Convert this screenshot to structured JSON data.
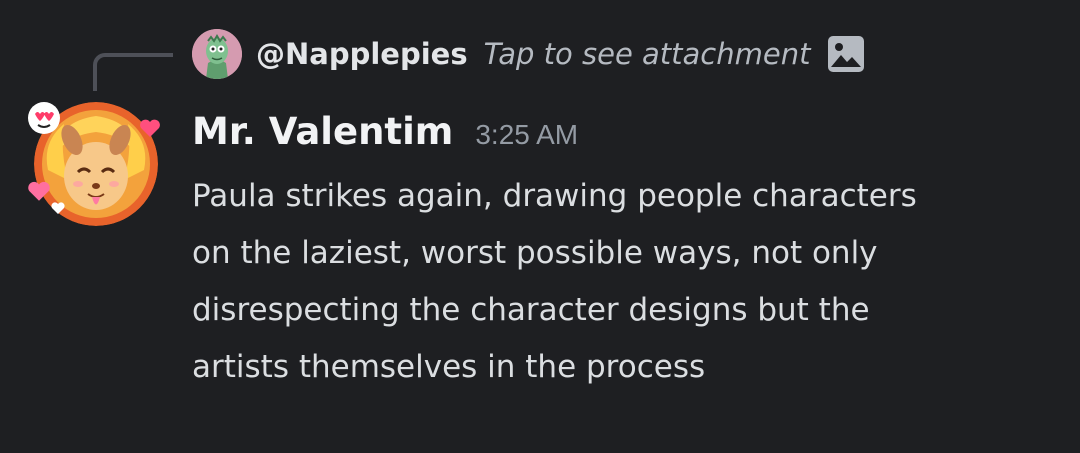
{
  "reply": {
    "username": "@Napplepies",
    "preview_text": "Tap to see attachment",
    "avatar_icon": "green-zombie-avatar",
    "attachment_icon": "image-icon"
  },
  "message": {
    "author": "Mr. Valentim",
    "timestamp": "3:25 AM",
    "lines": [
      "Paula strikes again, drawing people characters",
      "on the laziest, worst possible ways, not only",
      "disrespecting the character designs but the",
      "artists themselves in the process"
    ],
    "avatar_icon": "blonde-dog-character-avatar",
    "avatar_decoration": "hearts-eyes-emoji-decoration"
  },
  "colors": {
    "background": "#1e1f22",
    "author": "#f2f3f5",
    "body_text": "#dbdee1",
    "muted": "#949ba4",
    "reply_spine": "#4e5058"
  }
}
